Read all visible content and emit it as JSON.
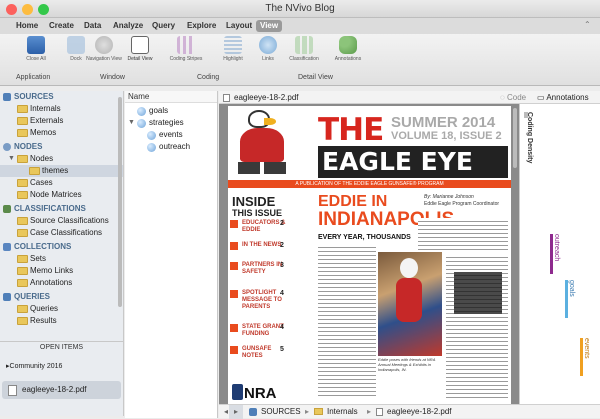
{
  "window": {
    "title": "The NVivo Blog"
  },
  "ribbon_tabs": [
    "Home",
    "Create",
    "Data",
    "Analyze",
    "Query",
    "Explore",
    "Layout",
    "View"
  ],
  "ribbon": {
    "buttons": {
      "close_all": "Close All",
      "dock": "Dock",
      "navigation_view": "Navigation View",
      "detail_view": "Detail View",
      "coding_stripes": "Coding Stripes",
      "highlight": "Highlight",
      "links": "Links",
      "classification": "Classification",
      "annotations": "Annotations"
    },
    "groups": {
      "application": "Application",
      "window": "Window",
      "coding": "Coding",
      "detail_view": "Detail View"
    }
  },
  "nav": {
    "sources": {
      "label": "SOURCES",
      "items": [
        "Internals",
        "Externals",
        "Memos"
      ]
    },
    "nodes": {
      "label": "NODES",
      "items": [
        "Nodes",
        "themes",
        "Cases",
        "Node Matrices"
      ]
    },
    "classifications": {
      "label": "CLASSIFICATIONS",
      "items": [
        "Source Classifications",
        "Case Classifications"
      ]
    },
    "collections": {
      "label": "COLLECTIONS",
      "items": [
        "Sets",
        "Memo Links",
        "Annotations"
      ]
    },
    "queries": {
      "label": "QUERIES",
      "items": [
        "Queries",
        "Results"
      ]
    }
  },
  "open_items": {
    "label": "OPEN ITEMS",
    "project": "Community 2016",
    "file": "eagleeye-18-2.pdf"
  },
  "detail_list": {
    "header": "Name",
    "nodes": [
      "goals",
      "strategies",
      "events",
      "outreach"
    ]
  },
  "document": {
    "tab_name": "eagleeye-18-2.pdf",
    "code_label": "Code",
    "annotations_label": "Annotations",
    "coding_density": "Coding Density",
    "stripes": [
      "outreach",
      "goals",
      "events"
    ],
    "status_path": [
      "SOURCES",
      "Internals",
      "eagleeye-18-2.pdf"
    ]
  },
  "newsletter": {
    "title_line1": "THE",
    "title_line2": "EAGLE EYE",
    "issue_season": "SUMMER 2014",
    "issue_vol": "VOLUME 18, ISSUE 2",
    "tagline": "A PUBLICATION OF THE EDDIE EAGLE GUNSAFE® PROGRAM",
    "inside_label": "INSIDE",
    "this_issue": "THIS ISSUE",
    "toc": [
      "EDUCATORS & EDDIE",
      "IN THE NEWS",
      "PARTNERS IN SAFETY",
      "SPOTLIGHT MESSAGE TO PARENTS",
      "STATE GRANT FUNDING",
      "GUNSAFE NOTES"
    ],
    "toc_pages": [
      "2",
      "2",
      "3",
      "4",
      "4",
      "5"
    ],
    "nra": "NRA",
    "headline1": "EDDIE IN",
    "headline2": "INDIANAPOLIS",
    "byline": "By: Marianne Johnson",
    "byline_role": "Eddie Eagle Program Coordinator",
    "lede": "EVERY YEAR, THOUSANDS",
    "photo_caption": "Eddie poses with friends at NRA Annual Meetings & Exhibits in Indianapolis, IN."
  },
  "colors": {
    "accent": "#e94b1e",
    "title_red": "#d7261e",
    "stripe_outreach": "#8e2a8e",
    "stripe_goals": "#5bb0e0",
    "stripe_events": "#f0a020"
  }
}
